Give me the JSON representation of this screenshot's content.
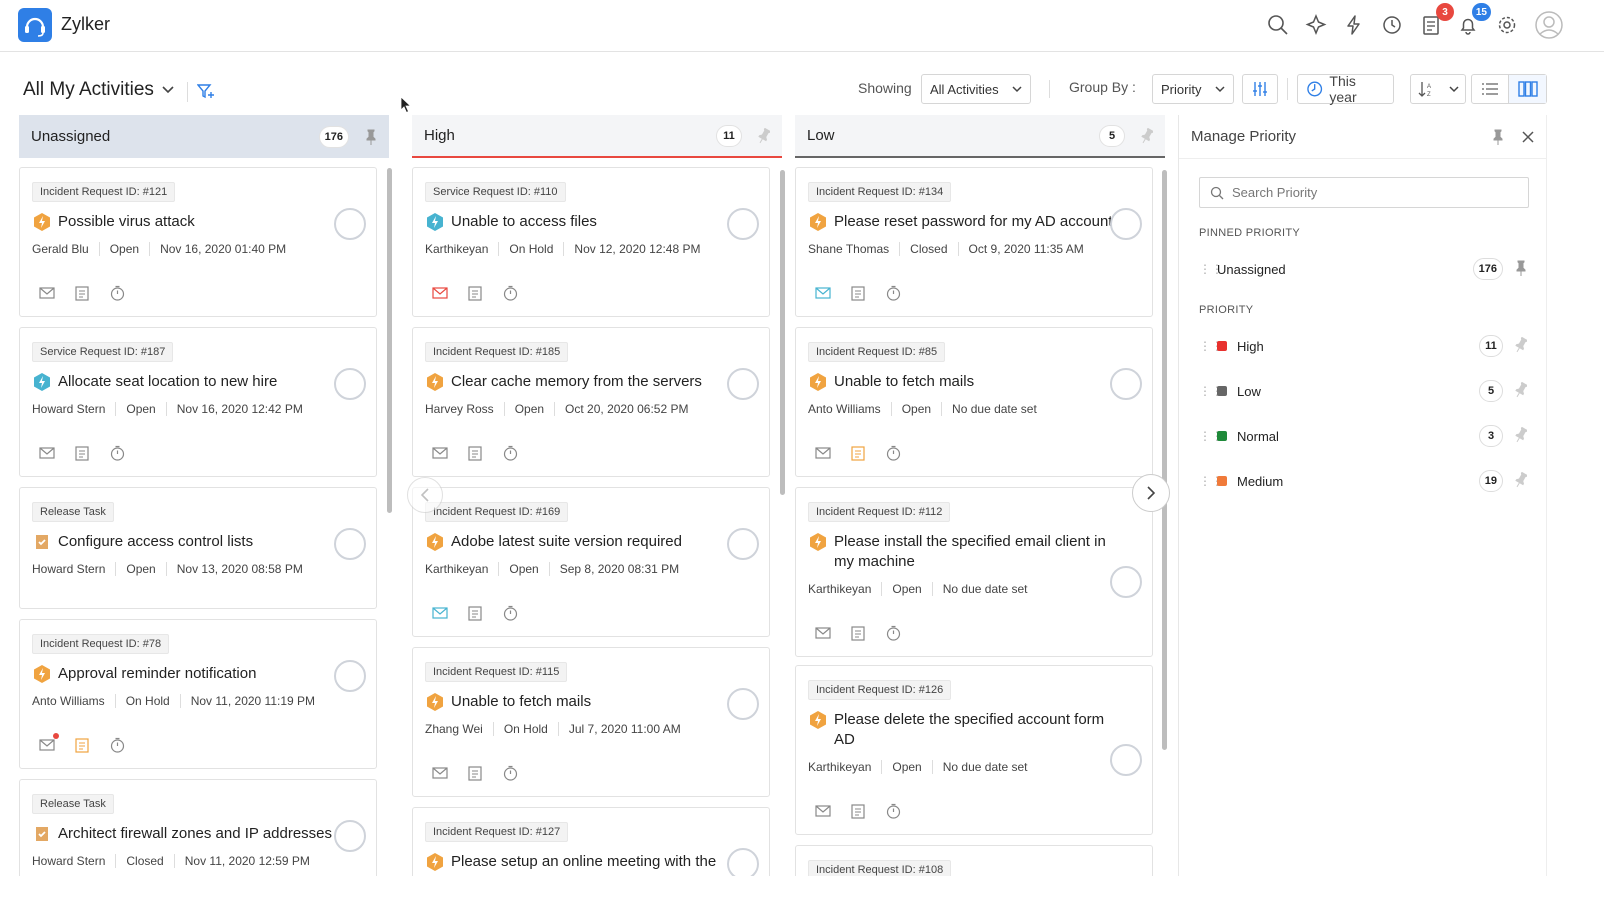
{
  "header": {
    "app_name": "Zylker",
    "icons": [
      "search-icon",
      "magic-icon",
      "lightning-icon",
      "history-icon",
      "tasks-icon",
      "bell-icon",
      "gear-icon",
      "avatar-icon"
    ],
    "tasks_badge": "3",
    "notifications_badge": "15",
    "badge_colors": {
      "tasks": "#e8483f",
      "notifications": "#2f7fe6"
    }
  },
  "toolbar": {
    "view_title": "All My Activities",
    "showing_label": "Showing",
    "showing_value": "All Activities",
    "group_by_label": "Group By :",
    "group_by_value": "Priority",
    "time_filter": "This year"
  },
  "columns": [
    {
      "title": "Unassigned",
      "count": "176",
      "cards": [
        {
          "tag": "Incident Request ID: #121",
          "title": "Possible virus attack",
          "type": "incident",
          "meta": [
            "Gerald Blu",
            "Open",
            "Nov 16, 2020 01:40 PM"
          ]
        },
        {
          "tag": "Service Request ID: #187",
          "title": "Allocate seat location to new hire",
          "type": "service",
          "meta": [
            "Howard Stern",
            "Open",
            "Nov 16, 2020 12:42 PM"
          ]
        },
        {
          "tag": "Release Task",
          "title": "Configure access control lists",
          "type": "release",
          "meta": [
            "Howard Stern",
            "Open",
            "Nov 13, 2020 08:58 PM"
          ]
        },
        {
          "tag": "Incident Request ID: #78",
          "title": "Approval reminder notification",
          "type": "incident",
          "meta": [
            "Anto Williams",
            "On Hold",
            "Nov 11, 2020 11:19 PM"
          ]
        },
        {
          "tag": "Release Task",
          "title": "Architect firewall zones and IP addresses",
          "type": "release",
          "meta": [
            "Howard Stern",
            "Closed",
            "Nov 11, 2020 12:59 PM"
          ]
        }
      ]
    },
    {
      "title": "High",
      "count": "11",
      "accent": "#e8483f",
      "cards": [
        {
          "tag": "Service Request ID: #110",
          "title": "Unable to access files",
          "type": "service",
          "meta": [
            "Karthikeyan",
            "On Hold",
            "Nov 12, 2020 12:48 PM"
          ]
        },
        {
          "tag": "Incident Request ID: #185",
          "title": "Clear cache memory from the servers",
          "type": "incident",
          "meta": [
            "Harvey Ross",
            "Open",
            "Oct 20, 2020 06:52 PM"
          ]
        },
        {
          "tag": "Incident Request ID: #169",
          "title": "Adobe latest suite version required",
          "type": "incident",
          "meta": [
            "Karthikeyan",
            "Open",
            "Sep 8, 2020 08:31 PM"
          ]
        },
        {
          "tag": "Incident Request ID: #115",
          "title": "Unable to fetch mails",
          "type": "incident",
          "meta": [
            "Zhang Wei",
            "On Hold",
            "Jul 7, 2020 11:00 AM"
          ]
        },
        {
          "tag": "Incident Request ID: #127",
          "title": "Please setup an online meeting with the",
          "type": "incident",
          "meta": []
        }
      ]
    },
    {
      "title": "Low",
      "count": "5",
      "accent": "#666666",
      "cards": [
        {
          "tag": "Incident Request ID: #134",
          "title": "Please reset password for my AD account",
          "type": "incident",
          "meta": [
            "Shane Thomas",
            "Closed",
            "Oct 9, 2020 11:35 AM"
          ]
        },
        {
          "tag": "Incident Request ID: #85",
          "title": "Unable to fetch mails",
          "type": "incident",
          "meta": [
            "Anto Williams",
            "Open",
            "No due date set"
          ]
        },
        {
          "tag": "Incident Request ID: #112",
          "title": "Please install the specified email client in my machine",
          "type": "incident",
          "meta": [
            "Karthikeyan",
            "Open",
            "No due date set"
          ]
        },
        {
          "tag": "Incident Request ID: #126",
          "title": "Please delete the specified account form AD",
          "type": "incident",
          "meta": [
            "Karthikeyan",
            "Open",
            "No due date set"
          ]
        },
        {
          "tag": "Incident Request ID: #108",
          "title": "",
          "type": "incident",
          "meta": []
        }
      ]
    }
  ],
  "panel": {
    "title": "Manage Priority",
    "search_placeholder": "Search Priority",
    "pinned_label": "PINNED PRIORITY",
    "priority_label": "PRIORITY",
    "pinned": [
      {
        "name": "Unassigned",
        "count": "176"
      }
    ],
    "priorities": [
      {
        "name": "High",
        "count": "11",
        "color": "#e8312e"
      },
      {
        "name": "Low",
        "count": "5",
        "color": "#666666"
      },
      {
        "name": "Normal",
        "count": "3",
        "color": "#1f8a3a"
      },
      {
        "name": "Medium",
        "count": "19",
        "color": "#f07a3a"
      }
    ]
  }
}
